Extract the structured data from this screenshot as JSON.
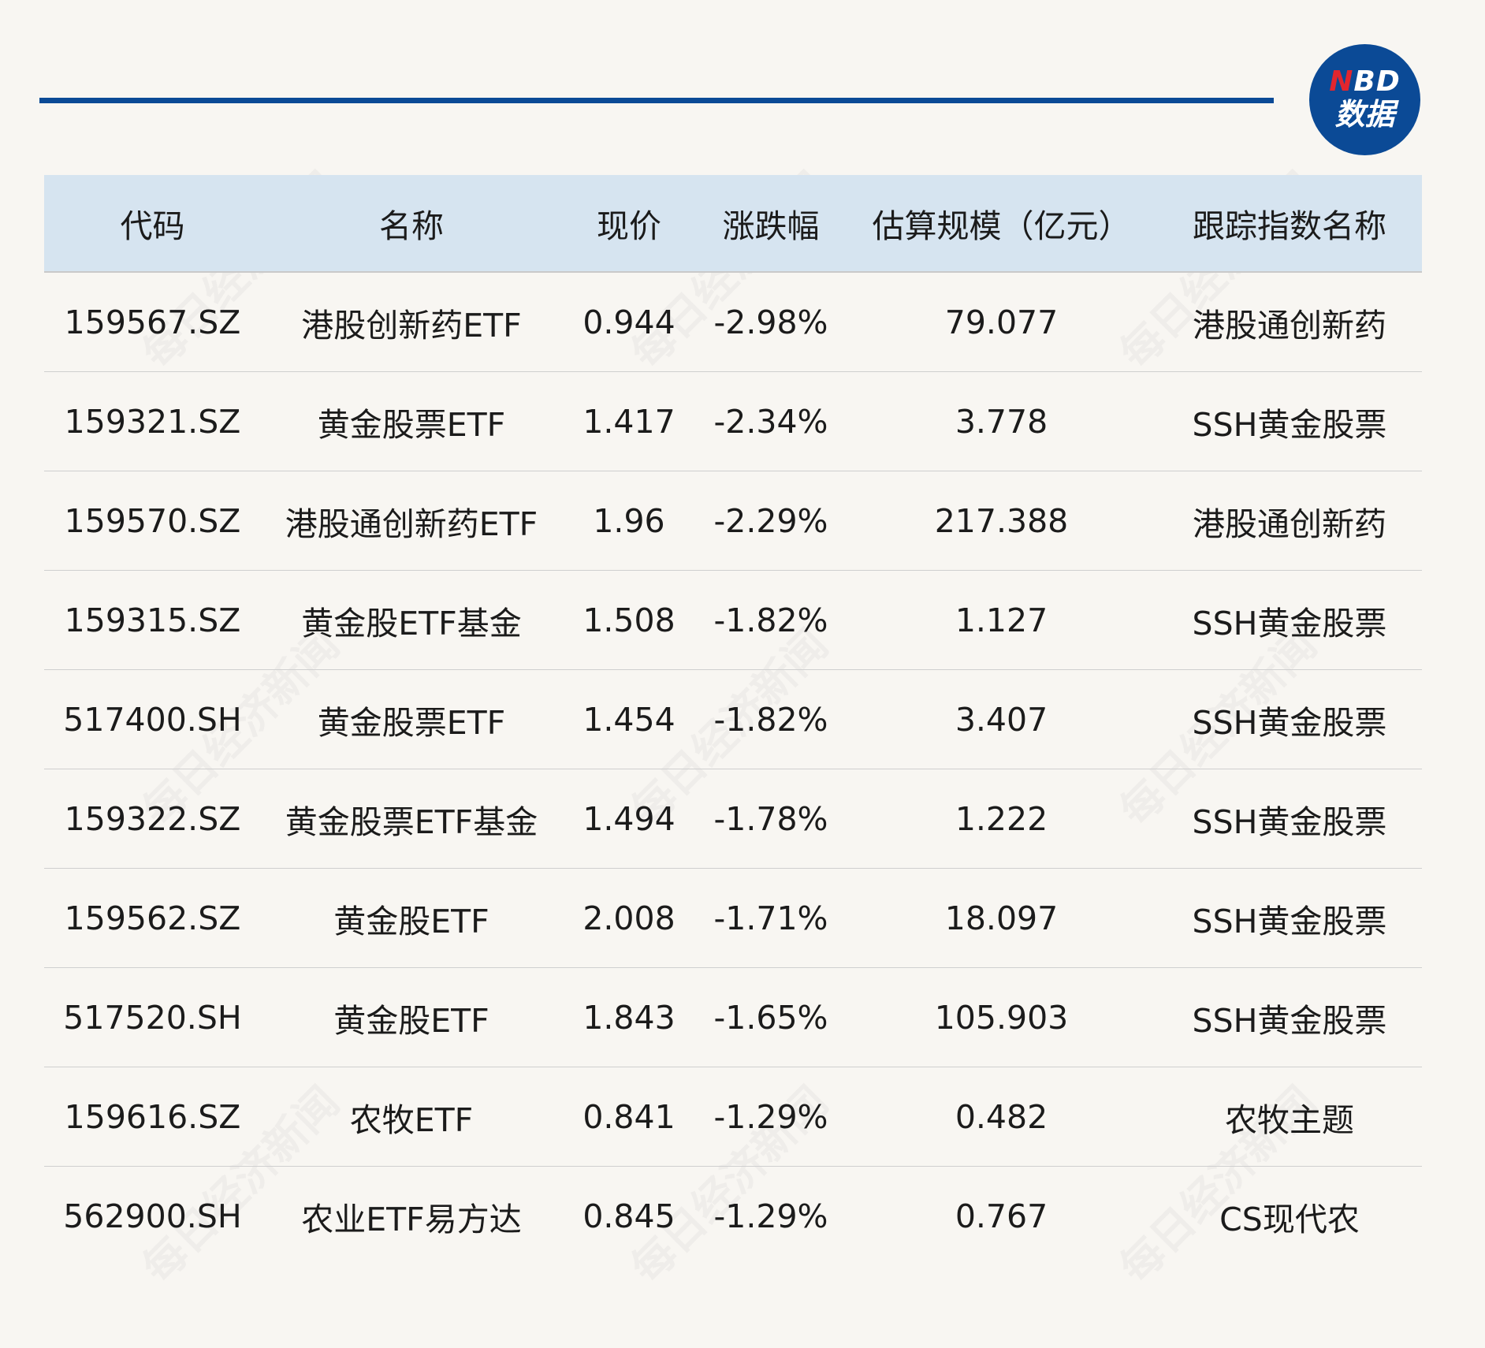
{
  "logo": {
    "line1_n": "N",
    "line1_rest": "BD",
    "line2": "数据"
  },
  "watermark": "每日经济新闻",
  "table": {
    "headers": [
      "代码",
      "名称",
      "现价",
      "涨跌幅",
      "估算规模（亿元）",
      "跟踪指数名称"
    ],
    "rows": [
      [
        "159567.SZ",
        "港股创新药ETF",
        "0.944",
        "-2.98%",
        "79.077",
        "港股通创新药"
      ],
      [
        "159321.SZ",
        "黄金股票ETF",
        "1.417",
        "-2.34%",
        "3.778",
        "SSH黄金股票"
      ],
      [
        "159570.SZ",
        "港股通创新药ETF",
        "1.96",
        "-2.29%",
        "217.388",
        "港股通创新药"
      ],
      [
        "159315.SZ",
        "黄金股ETF基金",
        "1.508",
        "-1.82%",
        "1.127",
        "SSH黄金股票"
      ],
      [
        "517400.SH",
        "黄金股票ETF",
        "1.454",
        "-1.82%",
        "3.407",
        "SSH黄金股票"
      ],
      [
        "159322.SZ",
        "黄金股票ETF基金",
        "1.494",
        "-1.78%",
        "1.222",
        "SSH黄金股票"
      ],
      [
        "159562.SZ",
        "黄金股ETF",
        "2.008",
        "-1.71%",
        "18.097",
        "SSH黄金股票"
      ],
      [
        "517520.SH",
        "黄金股ETF",
        "1.843",
        "-1.65%",
        "105.903",
        "SSH黄金股票"
      ],
      [
        "159616.SZ",
        "农牧ETF",
        "0.841",
        "-1.29%",
        "0.482",
        "农牧主题"
      ],
      [
        "562900.SH",
        "农业ETF易方达",
        "0.845",
        "-1.29%",
        "0.767",
        "CS现代农"
      ]
    ]
  },
  "colors": {
    "accent": "#0b4a96",
    "logo_n": "#e2262e",
    "header_bg": "#d6e4f0",
    "page_bg": "#f8f6f2"
  }
}
